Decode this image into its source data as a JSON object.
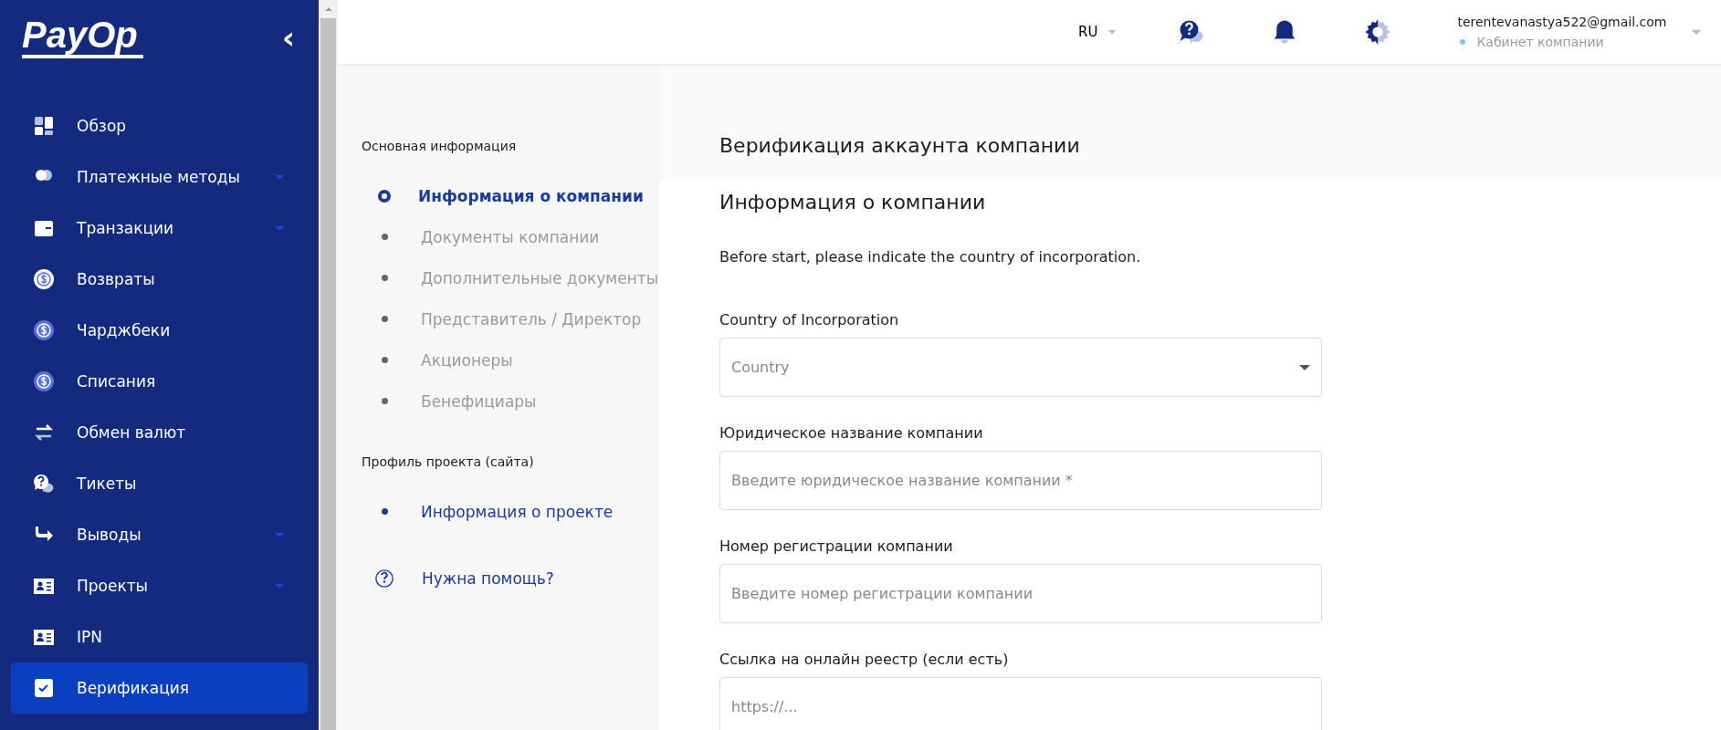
{
  "sidebar": {
    "logo": "PayOp",
    "collapse_icon": "‹",
    "items": [
      {
        "label": "Обзор",
        "expandable": false,
        "selected": false
      },
      {
        "label": "Платежные методы",
        "expandable": true,
        "selected": false
      },
      {
        "label": "Транзакции",
        "expandable": true,
        "selected": false
      },
      {
        "label": "Возвраты",
        "expandable": false,
        "selected": false
      },
      {
        "label": "Чарджбеки",
        "expandable": false,
        "selected": false
      },
      {
        "label": "Списания",
        "expandable": false,
        "selected": false
      },
      {
        "label": "Обмен валют",
        "expandable": false,
        "selected": false
      },
      {
        "label": "Тикеты",
        "expandable": false,
        "selected": false
      },
      {
        "label": "Выводы",
        "expandable": true,
        "selected": false
      },
      {
        "label": "Проекты",
        "expandable": true,
        "selected": false
      },
      {
        "label": "IPN",
        "expandable": false,
        "selected": false
      },
      {
        "label": "Верификация",
        "expandable": false,
        "selected": true
      }
    ]
  },
  "header": {
    "language": "RU",
    "email": "terentevanastya522@gmail.com",
    "account": "Кабинет компании"
  },
  "steps": {
    "groups": [
      {
        "title": "Основная информация",
        "items": [
          {
            "label": "Информация о компании",
            "selected": true,
            "disabled": false
          },
          {
            "label": "Документы компании",
            "selected": false,
            "disabled": true
          },
          {
            "label": "Дополнительные документы",
            "selected": false,
            "disabled": true
          },
          {
            "label": "Представитель / Директор",
            "selected": false,
            "disabled": true
          },
          {
            "label": "Акционеры",
            "selected": false,
            "disabled": true
          },
          {
            "label": "Бенефициары",
            "selected": false,
            "disabled": true
          }
        ]
      },
      {
        "title": "Профиль проекта (сайта)",
        "items": [
          {
            "label": "Информация о проекте",
            "selected": false,
            "disabled": false
          }
        ]
      }
    ],
    "help": "Нужна помощь?"
  },
  "form": {
    "title": "Верификация аккаунта компании",
    "section": "Информация о компании",
    "description": "Before start, please indicate the country of incorporation.",
    "fields": [
      {
        "kind": "select",
        "label": "Country of Incorporation",
        "placeholder": "Country"
      },
      {
        "kind": "input",
        "label": "Юридическое название компании",
        "placeholder": "Введите юридическое название компании *"
      },
      {
        "kind": "input",
        "label": "Номер регистрации компании",
        "placeholder": "Введите номер регистрации компании"
      },
      {
        "kind": "input",
        "label": "Ссылка на онлайн реестр (если есть)",
        "placeholder": "https://..."
      }
    ]
  }
}
